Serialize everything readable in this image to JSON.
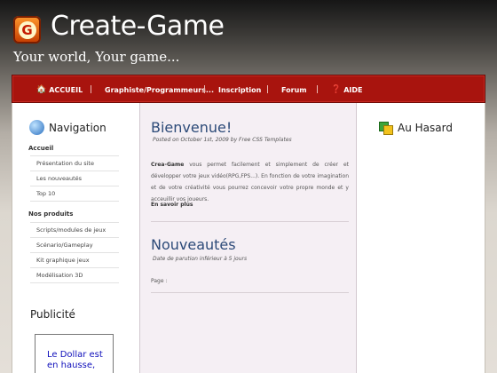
{
  "header": {
    "logo_letter": "G",
    "site_title": "Create-Game",
    "tagline": "Your world, Your game..."
  },
  "nav": {
    "items": [
      {
        "label": "ACCUEIL",
        "icon": "home-icon"
      },
      {
        "label": "Graphiste/Programmeurs...",
        "icon": ""
      },
      {
        "label": "Inscription",
        "icon": ""
      },
      {
        "label": "Forum",
        "icon": ""
      },
      {
        "label": "AIDE",
        "icon": "help-icon"
      }
    ]
  },
  "sidebar_left": {
    "title": "Navigation",
    "sections": [
      {
        "category": "Accueil",
        "links": [
          "Présentation du site",
          "Les nouveautés",
          "Top 10"
        ]
      },
      {
        "category": "Nos produits",
        "links": [
          "Scripts/modules de jeux",
          "Scénario/Gameplay",
          "Kit graphique jeux",
          "Modélisation 3D"
        ]
      }
    ],
    "ad_title": "Publicité",
    "ad_text_line1": "Le Dollar est",
    "ad_text_line2": "en hausse,"
  },
  "main": {
    "welcome_title": "Bienvenue!",
    "welcome_meta": "Posted on October 1st, 2009 by Free CSS Templates",
    "intro_bold": "Crea-Game",
    "intro_text": " vous permet facilement et simplement de créer et développer votre jeux vidéo(RPG,FPS...). En fonction de votre imagination et de votre créativité vous pourrez concevoir votre propre monde et y acceuillir vos joueurs.",
    "read_more": "En savoir plus",
    "news_title": "Nouveautés",
    "news_meta": "Date de parution inférieur à 5 jours",
    "page_label": "Page :"
  },
  "sidebar_right": {
    "title": "Au Hasard"
  },
  "colors": {
    "nav_bg": "#a8140e",
    "heading_blue": "#2c4a78",
    "ad_link": "#1010bb"
  }
}
